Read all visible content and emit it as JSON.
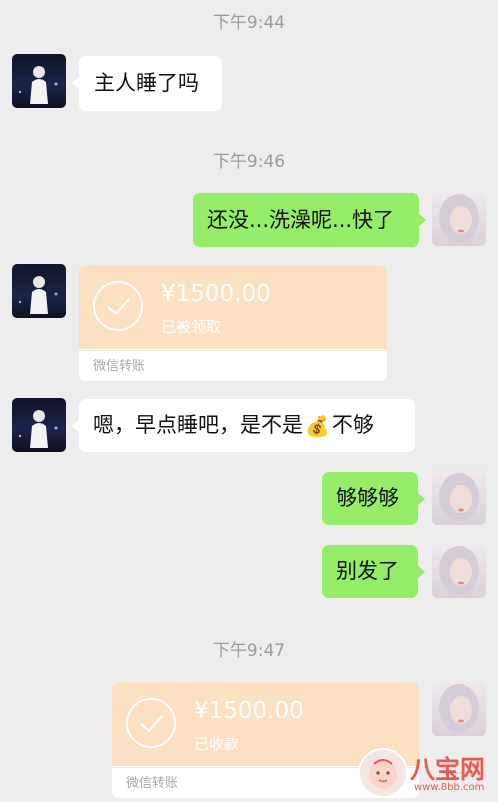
{
  "timestamps": [
    "下午9:44",
    "下午9:46",
    "下午9:47"
  ],
  "messages": {
    "m1": "主人睡了吗",
    "m2": "还没...洗澡呢...快了",
    "m3_before": "嗯，早点睡吧，是不是",
    "m3_emoji": "💰",
    "m3_after": "不够",
    "m4": "够够够",
    "m5": "别发了"
  },
  "transfers": [
    {
      "amount": "¥1500.00",
      "status": "已被领取",
      "label": "微信转账"
    },
    {
      "amount": "¥1500.00",
      "status": "已收款",
      "label": "微信转账"
    }
  ],
  "watermark": {
    "text": "八宝网",
    "url": "www.8bb.com"
  },
  "colors": {
    "background": "#ededed",
    "sent_bubble": "#95ec69",
    "received_bubble": "#ffffff",
    "transfer_card": "#fbe0c2"
  }
}
